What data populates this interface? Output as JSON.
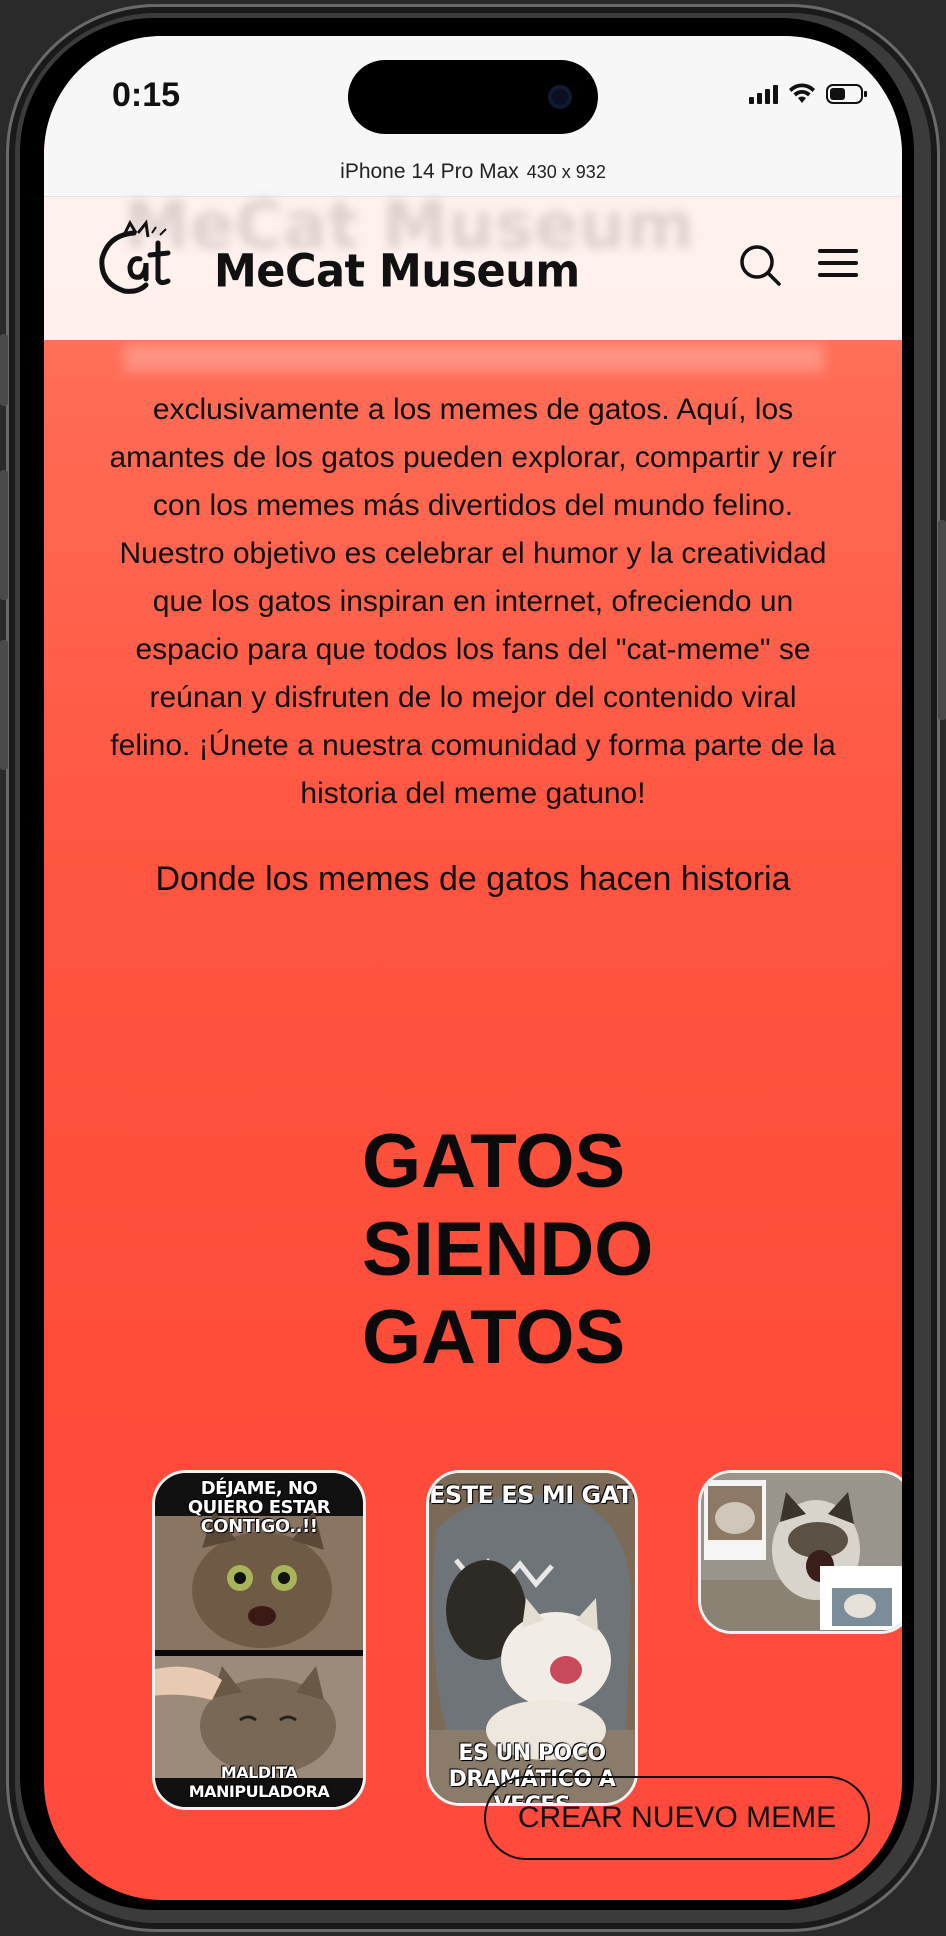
{
  "status_bar": {
    "time": "0:15",
    "device_name": "iPhone 14 Pro Max",
    "device_dims": "430 x 932"
  },
  "header": {
    "logo_text": "Cat",
    "brand": "MeCat Museum",
    "search_icon": "search-icon",
    "menu_icon": "hamburger-menu-icon"
  },
  "main": {
    "intro": "exclusivamente a los memes de gatos. Aquí, los amantes de los gatos pueden explorar, compartir y reír con los memes más divertidos del mundo felino. Nuestro objetivo es celebrar el humor y la creatividad que los gatos inspiran en internet, ofreciendo un espacio para que todos los fans del \"cat-meme\" se reúnan y disfruten de lo mejor del contenido viral felino. ¡Únete a nuestra comunidad y forma parte de la historia del meme gatuno!",
    "tagline": "Donde los memes de gatos hacen historia",
    "title_lines": [
      "GATOS",
      "SIENDO",
      "GATOS"
    ]
  },
  "carousel": [
    {
      "top_text": "DÉJAME, NO QUIERO ESTAR CONTIGO..!!",
      "bottom_text": "MALDITA MANIPULADORA"
    },
    {
      "top_text": "ESTE ES MI GATO...",
      "bottom_text": "ES UN POCO DRAMÁTICO A VECES"
    },
    {
      "top_text": "",
      "bottom_text": ""
    }
  ],
  "cta": {
    "label": "CREAR NUEVO MEME"
  },
  "colors": {
    "background_top": "#ff8a72",
    "background_bottom": "#ff4a3c",
    "header_bg": "#fff6f4",
    "text": "#111111"
  }
}
